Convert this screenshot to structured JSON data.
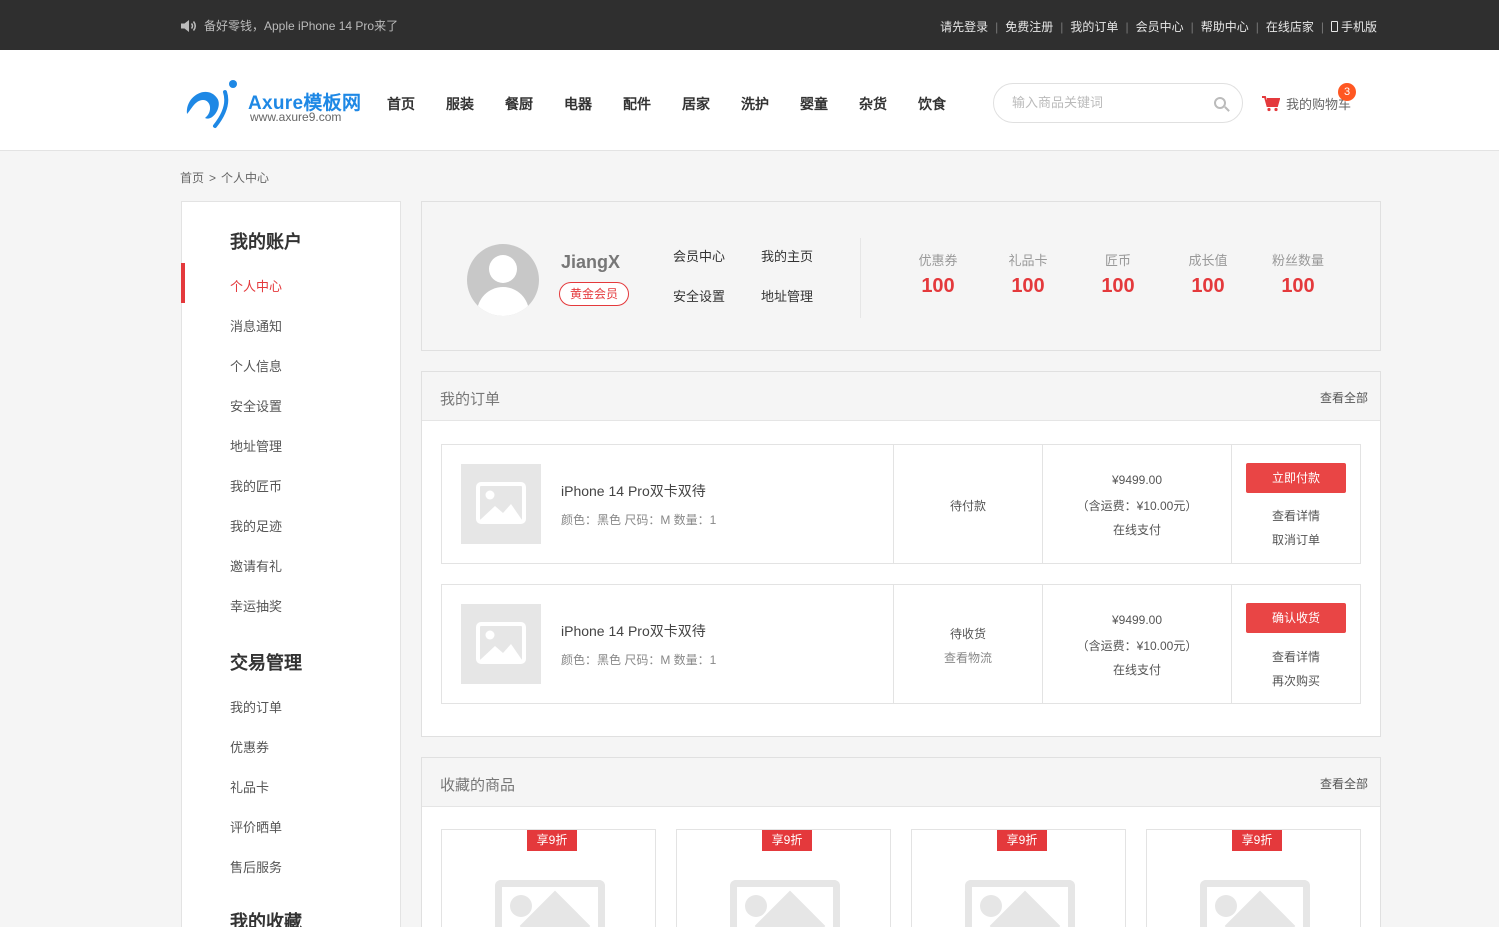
{
  "topbar": {
    "notice": "备好零钱，Apple iPhone 14 Pro来了",
    "links": [
      "请先登录",
      "免费注册",
      "我的订单",
      "会员中心",
      "帮助中心",
      "在线店家"
    ],
    "mobile": "手机版"
  },
  "header": {
    "logo_text": "Axure模板网",
    "logo_sub": "www.axure9.com",
    "nav": [
      "首页",
      "服装",
      "餐厨",
      "电器",
      "配件",
      "居家",
      "洗护",
      "婴童",
      "杂货",
      "饮食"
    ],
    "search_placeholder": "输入商品关键词",
    "cart_label": "我的购物车",
    "cart_count": "3"
  },
  "breadcrumb": {
    "home": "首页",
    "sep": ">",
    "current": "个人中心"
  },
  "sidebar": {
    "groups": [
      {
        "title": "我的账户",
        "items": [
          "个人中心",
          "消息通知",
          "个人信息",
          "安全设置",
          "地址管理",
          "我的匠币",
          "我的足迹",
          "邀请有礼",
          "幸运抽奖"
        ]
      },
      {
        "title": "交易管理",
        "items": [
          "我的订单",
          "优惠券",
          "礼品卡",
          "评价晒单",
          "售后服务"
        ]
      },
      {
        "title": "我的收藏",
        "items": []
      }
    ],
    "active": "个人中心"
  },
  "profile": {
    "username": "JiangX",
    "level": "黄金会员",
    "links": [
      "会员中心",
      "我的主页",
      "安全设置",
      "地址管理"
    ],
    "stats": [
      {
        "label": "优惠券",
        "value": "100"
      },
      {
        "label": "礼品卡",
        "value": "100"
      },
      {
        "label": "匠币",
        "value": "100"
      },
      {
        "label": "成长值",
        "value": "100"
      },
      {
        "label": "粉丝数量",
        "value": "100"
      }
    ]
  },
  "orders": {
    "title": "我的订单",
    "view_all": "查看全部",
    "items": [
      {
        "name": "iPhone 14 Pro双卡双待",
        "spec": "颜色：黑色  尺码：M  数量：1",
        "status": "待付款",
        "status_link": "",
        "price": "¥9499.00",
        "shipping": "（含运费：¥10.00元）",
        "pay": "在线支付",
        "action": "立即付款",
        "links": [
          "查看详情",
          "取消订单"
        ]
      },
      {
        "name": "iPhone 14 Pro双卡双待",
        "spec": "颜色：黑色  尺码：M  数量：1",
        "status": "待收货",
        "status_link": "查看物流",
        "price": "¥9499.00",
        "shipping": "（含运费：¥10.00元）",
        "pay": "在线支付",
        "action": "确认收货",
        "links": [
          "查看详情",
          "再次购买"
        ]
      }
    ]
  },
  "favorites": {
    "title": "收藏的商品",
    "view_all": "查看全部",
    "tags": [
      "享9折",
      "享9折",
      "享9折",
      "享9折"
    ]
  },
  "colors": {
    "accent": "#e4393c",
    "topbar": "#2f2f2f",
    "brand": "#1e88e5"
  }
}
